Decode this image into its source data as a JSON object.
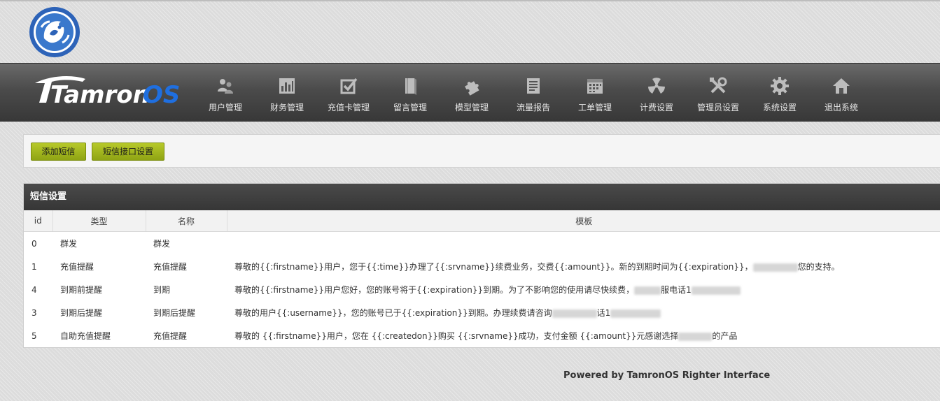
{
  "nav": {
    "items": [
      {
        "label": "用户管理",
        "icon": "users-icon"
      },
      {
        "label": "财务管理",
        "icon": "bar-chart-icon"
      },
      {
        "label": "充值卡管理",
        "icon": "checkbox-icon"
      },
      {
        "label": "留言管理",
        "icon": "book-icon"
      },
      {
        "label": "模型管理",
        "icon": "puzzle-icon"
      },
      {
        "label": "流量报告",
        "icon": "document-icon"
      },
      {
        "label": "工单管理",
        "icon": "calendar-icon"
      },
      {
        "label": "计费设置",
        "icon": "radiation-icon"
      },
      {
        "label": "管理员设置",
        "icon": "tools-icon"
      },
      {
        "label": "系统设置",
        "icon": "gear-icon"
      },
      {
        "label": "退出系统",
        "icon": "home-icon"
      }
    ]
  },
  "toolbar": {
    "add_label": "添加短信",
    "sms_settings_label": "短信接口设置"
  },
  "table": {
    "title": "短信设置",
    "columns": [
      "id",
      "类型",
      "名称",
      "模板"
    ],
    "rows": [
      {
        "id": "0",
        "type": "群发",
        "name": "群发",
        "template": ""
      },
      {
        "id": "1",
        "type": "充值提醒",
        "name": "充值提醒",
        "template": "尊敬的{{:firstname}}用户，您于{{:time}}办理了{{:srvname}}续费业务，交费{{:amount}}。新的到期时间为{{:expiration}}，",
        "template_tail": "您的支持。"
      },
      {
        "id": "4",
        "type": "到期前提醒",
        "name": "到期",
        "template": "尊敬的{{:firstname}}用户您好，您的账号将于{{:expiration}}到期。为了不影响您的使用请尽快续费，",
        "template_tail": "服电话1"
      },
      {
        "id": "3",
        "type": "到期后提醒",
        "name": "到期后提醒",
        "template": "尊敬的用户{{:username}}，您的账号已于{{:expiration}}到期。办理续费请咨询",
        "template_tail": "话1"
      },
      {
        "id": "5",
        "type": "自助充值提醒",
        "name": "充值提醒",
        "template": "尊敬的 {{:firstname}}用户，您在 {{:createdon}}购买 {{:srvname}}成功，支付金额 {{:amount}}元感谢选择",
        "template_tail": "的产品"
      }
    ]
  },
  "brand": {
    "text_a": "Tamron",
    "text_b": "OS"
  },
  "footer": {
    "text": "Powered by TamronOS Righter Interface"
  },
  "colors": {
    "button": "#9fb51c",
    "brand_blue": "#1f6fe0",
    "nav_bg": "#4b4b4b"
  }
}
